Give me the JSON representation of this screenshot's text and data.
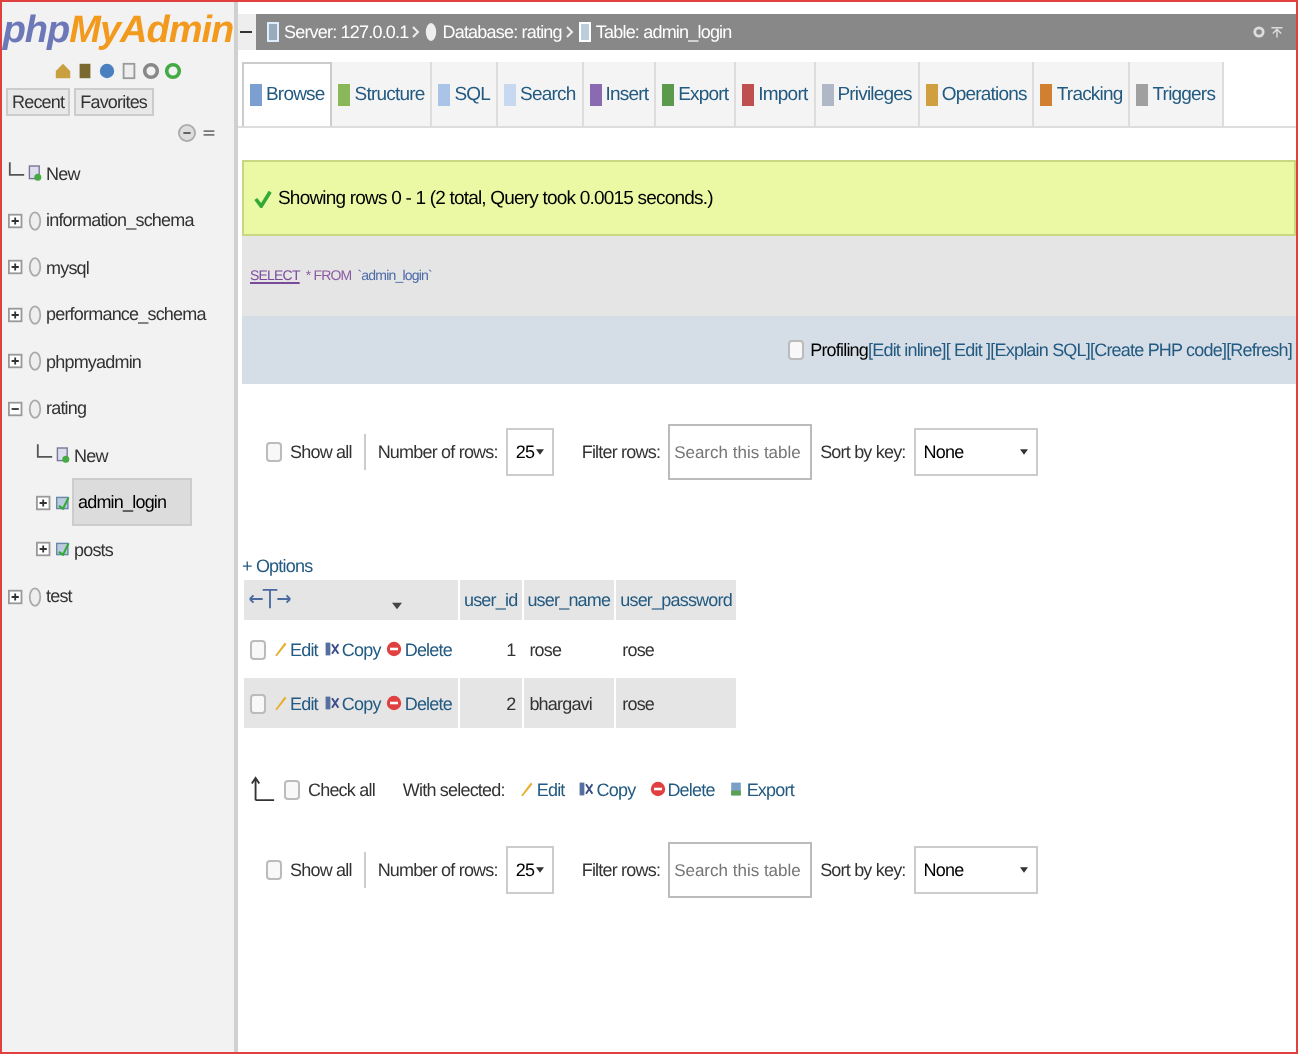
{
  "logo": {
    "part_1": "php",
    "part_2": "MyAdmin"
  },
  "sidebar": {
    "tabs": [
      "Recent",
      "Favorites"
    ],
    "tree": [
      {
        "kind": "new",
        "label": "New",
        "selected": false
      },
      {
        "kind": "db",
        "label": "information_schema",
        "expanded": false,
        "selected": false
      },
      {
        "kind": "db",
        "label": "mysql",
        "expanded": false,
        "selected": false
      },
      {
        "kind": "db",
        "label": "performance_schema",
        "expanded": false,
        "selected": false
      },
      {
        "kind": "db",
        "label": "phpmyadmin",
        "expanded": false,
        "selected": false
      },
      {
        "kind": "db",
        "label": "rating",
        "expanded": true,
        "selected": false,
        "children": [
          {
            "kind": "new",
            "label": "New",
            "selected": false
          },
          {
            "kind": "table",
            "label": "admin_login",
            "expanded": false,
            "selected": true
          },
          {
            "kind": "table",
            "label": "posts",
            "expanded": false,
            "selected": false
          }
        ]
      },
      {
        "kind": "db",
        "label": "test",
        "expanded": false,
        "selected": false
      }
    ]
  },
  "breadcrumb": [
    {
      "kind": "server",
      "label": "Server: 127.0.0.1"
    },
    {
      "kind": "database",
      "label": "Database: rating"
    },
    {
      "kind": "table",
      "label": "Table: admin_login"
    }
  ],
  "tabs": [
    {
      "label": "Browse",
      "selected": true
    },
    {
      "label": "Structure",
      "selected": false
    },
    {
      "label": "SQL",
      "selected": false
    },
    {
      "label": "Search",
      "selected": false
    },
    {
      "label": "Insert",
      "selected": false
    },
    {
      "label": "Export",
      "selected": false
    },
    {
      "label": "Import",
      "selected": false
    },
    {
      "label": "Privileges",
      "selected": false
    },
    {
      "label": "Operations",
      "selected": false
    },
    {
      "label": "Tracking",
      "selected": false
    },
    {
      "label": "Triggers",
      "selected": false
    }
  ],
  "message": "Showing rows 0 - 1 (2 total, Query took 0.0015 seconds.)",
  "sql": {
    "keyword": "SELECT",
    "operator": "* FROM",
    "identifier": "`admin_login`"
  },
  "profiling": {
    "label": "Profiling",
    "checked": false,
    "links": [
      "[Edit inline]",
      "[ Edit ]",
      "[Explain SQL]",
      "[Create PHP code]",
      "[Refresh]"
    ]
  },
  "navigation": [
    {
      "show_all": "Show all",
      "show_all_checked": false,
      "rows_label": "Number of rows:",
      "rows_value": "25",
      "filter_label": "Filter rows:",
      "filter_placeholder": "Search this table",
      "sort_label": "Sort by key:",
      "sort_value": "None"
    },
    {
      "show_all": "Show all",
      "show_all_checked": false,
      "rows_label": "Number of rows:",
      "rows_value": "25",
      "filter_label": "Filter rows:",
      "filter_placeholder": "Search this table",
      "sort_label": "Sort by key:",
      "sort_value": "None"
    }
  ],
  "options": "+ Options",
  "table": {
    "columns": [
      "user_id",
      "user_name",
      "user_password"
    ],
    "rows": [
      {
        "checked": false,
        "actions": [
          "Edit",
          "Copy",
          "Delete"
        ],
        "user_id": "1",
        "user_name": "rose",
        "user_password": "rose"
      },
      {
        "checked": false,
        "actions": [
          "Edit",
          "Copy",
          "Delete"
        ],
        "user_id": "2",
        "user_name": "bhargavi",
        "user_password": "rose"
      }
    ]
  },
  "bulk": {
    "check_all": "Check all",
    "checked": false,
    "with_selected": "With selected:",
    "actions": [
      "Edit",
      "Copy",
      "Delete",
      "Export"
    ]
  }
}
